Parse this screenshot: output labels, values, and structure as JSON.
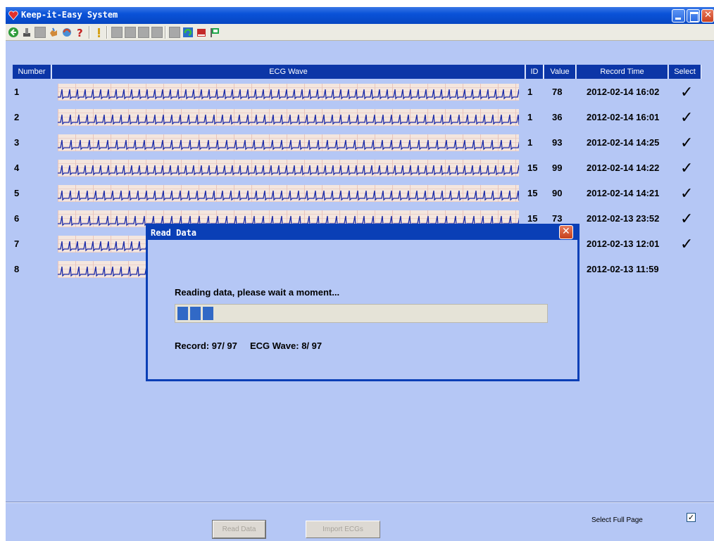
{
  "window": {
    "title": "Keep-it-Easy System"
  },
  "toolbar": {
    "icons": [
      "back-icon",
      "stamp-icon",
      "gray-icon",
      "hand-icon",
      "refresh-icon",
      "help-icon",
      "info-icon",
      "disabled-icon",
      "disabled-icon",
      "disabled-icon",
      "disabled-icon",
      "disabled-icon",
      "rotate-icon",
      "book-icon",
      "flag-icon"
    ]
  },
  "table": {
    "headers": {
      "number": "Number",
      "ecg": "ECG Wave",
      "id": "ID",
      "value": "Value",
      "time": "Record Time",
      "select": "Select"
    },
    "rows": [
      {
        "number": "1",
        "id": "1",
        "value": "78",
        "time": "2012-02-14 16:02",
        "selected": "✓"
      },
      {
        "number": "2",
        "id": "1",
        "value": "36",
        "time": "2012-02-14 16:01",
        "selected": "✓"
      },
      {
        "number": "3",
        "id": "1",
        "value": "93",
        "time": "2012-02-14 14:25",
        "selected": "✓"
      },
      {
        "number": "4",
        "id": "15",
        "value": "99",
        "time": "2012-02-14 14:22",
        "selected": "✓"
      },
      {
        "number": "5",
        "id": "15",
        "value": "90",
        "time": "2012-02-14 14:21",
        "selected": "✓"
      },
      {
        "number": "6",
        "id": "15",
        "value": "73",
        "time": "2012-02-13 23:52",
        "selected": "✓"
      },
      {
        "number": "7",
        "id": "",
        "value": "",
        "time": "2012-02-13 12:01",
        "selected": "✓"
      },
      {
        "number": "8",
        "id": "",
        "value": "",
        "time": "2012-02-13 11:59",
        "selected": ""
      }
    ]
  },
  "dialog": {
    "title": "Read Data",
    "message": "Reading data, please wait a moment...",
    "progress_blocks": 3,
    "record_label": "Record:",
    "record_value": "97/ 97",
    "ecg_label": "ECG Wave:",
    "ecg_value": "8/ 97"
  },
  "footer": {
    "read_data_label": "Read Data",
    "import_ecgs_label": "Import ECGs",
    "select_full_page_label": "Select Full Page",
    "select_full_page_checked": "✓"
  },
  "colors": {
    "title_bar": "#0a52d8",
    "background": "#b5c7f5",
    "header": "#0c36a7",
    "ecg_trace": "#1a2aa8",
    "progress": "#3169c6"
  }
}
